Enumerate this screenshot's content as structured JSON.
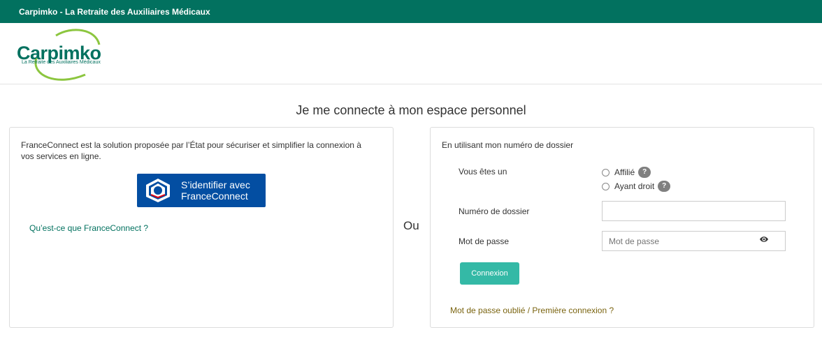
{
  "topbar": {
    "title": "Carpimko - La Retraite des Auxiliaires Médicaux"
  },
  "logo": {
    "word": "Carpimko",
    "tagline": "La Retraite des Auxiliaires Médicaux"
  },
  "page_title": "Je me connecte à mon espace personnel",
  "franceconnect": {
    "description": "FranceConnect est la solution proposée par l’État pour sécuriser et simplifier la connexion à vos services en ligne.",
    "button_line1": "S’identifier avec",
    "button_line2": "FranceConnect",
    "link": "Qu’est-ce que FranceConnect ?"
  },
  "separator": "Ou",
  "login": {
    "heading": "En utilisant mon numéro de dossier",
    "role_label": "Vous êtes un",
    "options": [
      {
        "label": "Affilié",
        "help": "?"
      },
      {
        "label": "Ayant droit",
        "help": "?"
      }
    ],
    "dossier_label": "Numéro de dossier",
    "dossier_value": "",
    "password_label": "Mot de passe",
    "password_placeholder": "Mot de passe",
    "submit": "Connexion",
    "forgot": "Mot de passe oublié / Première connexion ?"
  },
  "colors": {
    "brand": "#02715f",
    "button": "#34b9a6",
    "fc_blue": "#034ea2",
    "link_gold": "#7a6410"
  }
}
